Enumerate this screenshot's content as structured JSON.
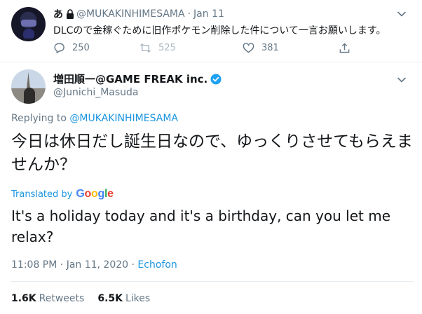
{
  "parent_tweet": {
    "name": "あ",
    "handle": "@MUKAKINHIMESAMA",
    "separator": "·",
    "date": "Jan 11",
    "text": "DLCので金稼ぐために旧作ポケモン削除した件について一言お願いします。",
    "reply_count": "250",
    "retweet_count": "525",
    "like_count": "381"
  },
  "main_tweet": {
    "name": "増田順一@GAME FREAK inc.",
    "handle": "@Junichi_Masuda",
    "replying_prefix": "Replying to",
    "replying_to": "@MUKAKINHIMESAMA",
    "text": "今日は休日だし誕生日なので、ゆっくりさせてもらえませんか？",
    "translated_by": "Translated by",
    "translation": "It's a holiday today and it's a birthday, can you let me relax?",
    "time": "11:08 PM",
    "meta_separator": "·",
    "date": "Jan 11, 2020",
    "source": "Echofon",
    "retweets_count": "1.6K",
    "retweets_label": "Retweets",
    "likes_count": "6.5K",
    "likes_label": "Likes"
  },
  "colors": {
    "link": "#1b95e0",
    "secondary_text": "#657786",
    "primary_text": "#14171a",
    "verified": "#1da1f2"
  }
}
